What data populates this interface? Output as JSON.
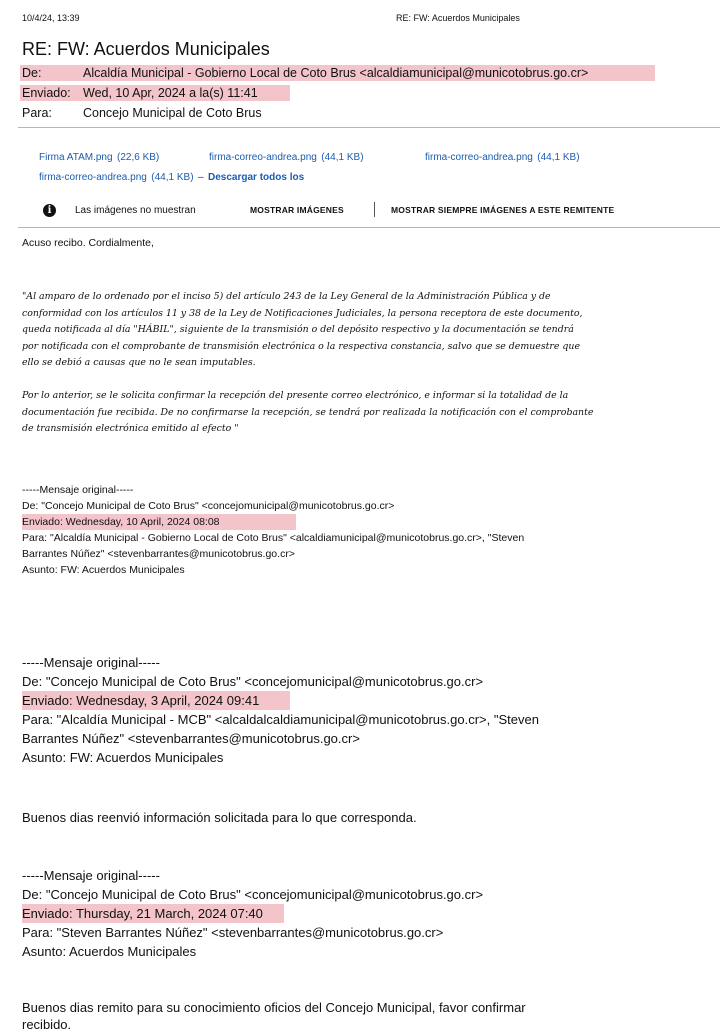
{
  "print_header": {
    "datetime": "10/4/24, 13:39",
    "title": "RE: FW: Acuerdos Municipales"
  },
  "subject": "RE: FW: Acuerdos Municipales",
  "headers": {
    "from_label": "De:",
    "from_value": "Alcaldía Municipal - Gobierno Local de Coto Brus <alcaldiamunicipal@municotobrus.go.cr>",
    "sent_label": "Enviado:",
    "sent_value": "Wed, 10 Apr, 2024 a la(s) 11:41",
    "to_label": "Para:",
    "to_value": "Concejo Municipal de Coto Brus"
  },
  "attachments": [
    {
      "name": "Firma ATAM.png",
      "size": "(22,6 KB)"
    },
    {
      "name": "firma-correo-andrea.png",
      "size": "(44,1 KB)"
    },
    {
      "name": "firma-correo-andrea.png",
      "size": "(44,1 KB)"
    },
    {
      "name": "firma-correo-andrea.png",
      "size": "(44,1 KB)"
    }
  ],
  "download_all": "Descargar todos los",
  "download_dash": "–",
  "image_notice": {
    "message": "Las imágenes no muestran",
    "show_images": "MOSTRAR IMÁGENES",
    "always_show": "MOSTRAR SIEMPRE IMÁGENES A ESTE REMITENTE",
    "icon_glyph": "i"
  },
  "body": {
    "greeting": "Acuso recibo. Cordialmente,",
    "quote1": [
      "\"Al amparo de lo ordenado por el inciso 5) del artículo 243 de la Ley General de la Administración Pública y de",
      "conformidad con los artículos 11 y 38 de la Ley de Notificaciones Judiciales, la persona receptora de este documento,",
      "queda notificada al día \"HÁBIL\", siguiente de la transmisión o del depósito respectivo y la documentación se tendrá",
      "por notificada con el comprobante de transmisión electrónica o la respectiva constancia, salvo que se demuestre que",
      "ello se debió a causas que no le sean imputables."
    ],
    "quote2": [
      "Por lo anterior, se le solicita confirmar la recepción del presente correo electrónico, e informar si la totalidad de la",
      "documentación fue recibida. De no confirmarse la recepción, se tendrá por realizada la notificación con el comprobante",
      "de transmisión electrónica emitido al efecto \""
    ]
  },
  "original_messages": [
    {
      "separator": "-----Mensaje original-----",
      "from": "De: \"Concejo Municipal de Coto Brus\" <concejomunicipal@municotobrus.go.cr>",
      "sent": "Enviado: Wednesday, 10 April, 2024 08:08",
      "to_line1": "Para: \"Alcaldía Municipal - Gobierno Local de Coto Brus\" <alcaldiamunicipal@municotobrus.go.cr>, \"Steven",
      "to_line2": "Barrantes Núñez\" <stevenbarrantes@municotobrus.go.cr>",
      "subject": "Asunto: FW: Acuerdos Municipales"
    },
    {
      "separator": "-----Mensaje original-----",
      "from": "De: \"Concejo Municipal de Coto Brus\" <concejomunicipal@municotobrus.go.cr>",
      "sent": "Enviado: Wednesday, 3 April, 2024 09:41",
      "to_line1": "Para: \"Alcaldía Municipal - MCB\" <alcaldalcaldiamunicipal@municotobrus.go.cr>, \"Steven",
      "to_line2": "Barrantes Núñez\" <stevenbarrantes@municotobrus.go.cr>",
      "subject": "Asunto: FW: Acuerdos Municipales",
      "body": "Buenos dias reenvió información solicitada para lo que corresponda."
    },
    {
      "separator": "-----Mensaje original-----",
      "from": "De: \"Concejo Municipal de Coto Brus\" <concejomunicipal@municotobrus.go.cr>",
      "sent": "Enviado: Thursday, 21 March, 2024 07:40",
      "to_line1": "Para: \"Steven Barrantes Núñez\" <stevenbarrantes@municotobrus.go.cr>",
      "subject": "Asunto: Acuerdos Municipales",
      "body_line1": "Buenos dias remito para su conocimiento oficios del Concejo Municipal, favor confirmar",
      "body_line2": "recibido."
    }
  ],
  "colors": {
    "highlight": "#f3c4c9",
    "link": "#1a5cb0"
  }
}
